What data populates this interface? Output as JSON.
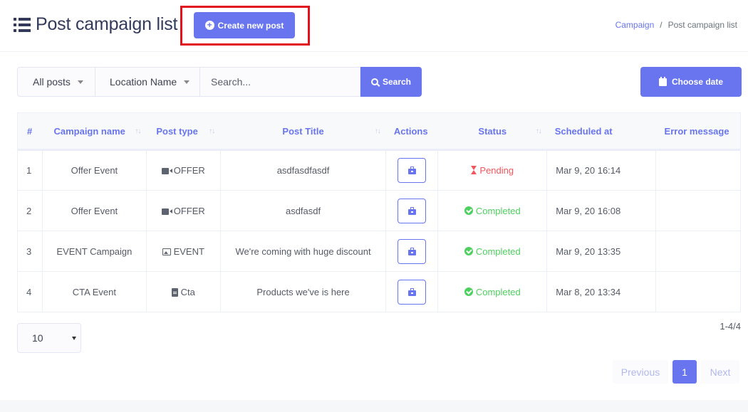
{
  "header": {
    "title": "Post campaign list",
    "icon": "list-icon",
    "create_button": {
      "label": "Create new post",
      "icon": "plus-circle-icon"
    },
    "highlight_color": "#e3101e",
    "breadcrumb": {
      "parent": "Campaign",
      "separator": "/",
      "current": "Post campaign list"
    }
  },
  "filters": {
    "post_filter": {
      "selected": "All posts"
    },
    "location_filter": {
      "selected": "Location Name"
    },
    "search": {
      "value": "",
      "placeholder": "Search..."
    },
    "search_button": {
      "label": "Search",
      "icon": "search-icon"
    },
    "date_button": {
      "label": "Choose date",
      "icon": "calendar-icon"
    }
  },
  "table": {
    "columns": [
      {
        "label": "#",
        "sortable": false
      },
      {
        "label": "Campaign name",
        "sortable": true
      },
      {
        "label": "Post type",
        "sortable": true
      },
      {
        "label": "Post Title",
        "sortable": true
      },
      {
        "label": "Actions",
        "sortable": false
      },
      {
        "label": "Status",
        "sortable": true
      },
      {
        "label": "Scheduled at",
        "sortable": false
      },
      {
        "label": "Error message",
        "sortable": false
      }
    ],
    "sort_glyph": "↑↓",
    "rows": [
      {
        "num": "1",
        "campaign": "Offer Event",
        "type": "OFFER",
        "type_icon": "video-icon",
        "title": "asdfasdfasdf",
        "action_icon": "briefcase-icon",
        "status": "Pending",
        "status_icon": "hourglass-icon",
        "scheduled": "Mar 9, 20 16:14",
        "error": ""
      },
      {
        "num": "2",
        "campaign": "Offer Event",
        "type": "OFFER",
        "type_icon": "video-icon",
        "title": "asdfasdf",
        "action_icon": "briefcase-icon",
        "status": "Completed",
        "status_icon": "check-circle-icon",
        "scheduled": "Mar 9, 20 16:08",
        "error": ""
      },
      {
        "num": "3",
        "campaign": "EVENT Campaign",
        "type": "EVENT",
        "type_icon": "image-icon",
        "title": "We're coming with huge discount",
        "action_icon": "briefcase-icon",
        "status": "Completed",
        "status_icon": "check-circle-icon",
        "scheduled": "Mar 9, 20 13:35",
        "error": ""
      },
      {
        "num": "4",
        "campaign": "CTA Event",
        "type": "Cta",
        "type_icon": "file-icon",
        "title": "Products we've is here",
        "action_icon": "briefcase-icon",
        "status": "Completed",
        "status_icon": "check-circle-icon",
        "scheduled": "Mar 8, 20 13:34",
        "error": ""
      }
    ]
  },
  "pagination": {
    "page_size": "10",
    "range": "1-4/4",
    "previous_label": "Previous",
    "current_page": "1",
    "next_label": "Next"
  },
  "colors": {
    "accent": "#6875ee",
    "pending": "#f0565a",
    "completed": "#4ed05f"
  }
}
